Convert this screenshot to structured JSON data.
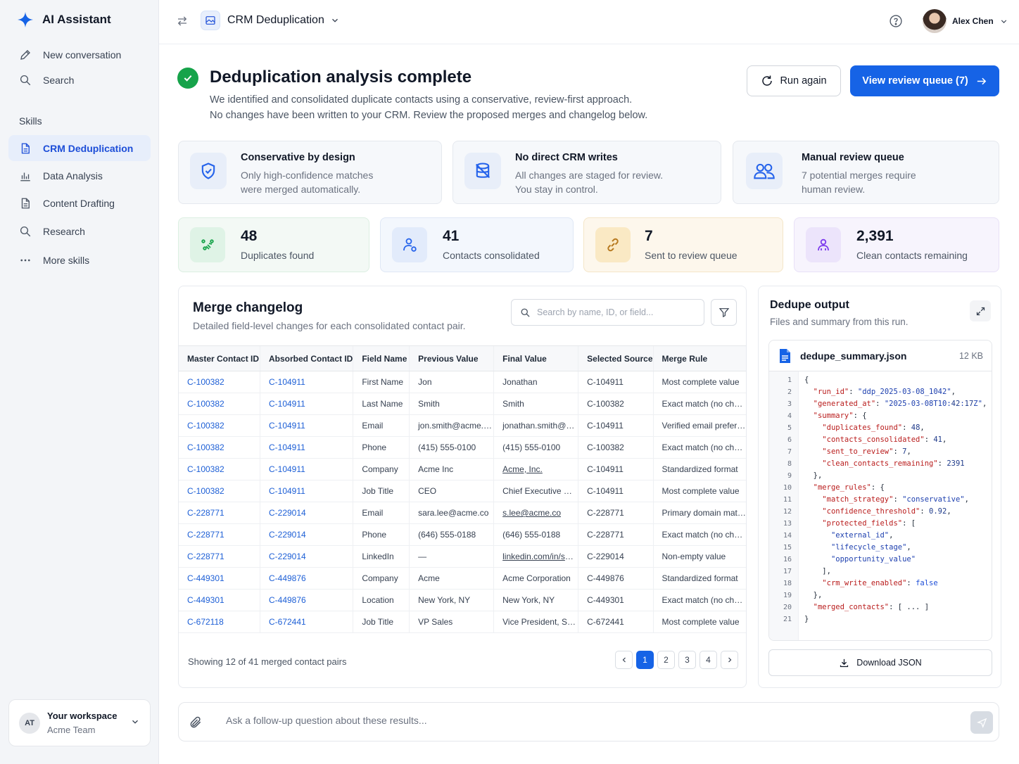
{
  "app": {
    "name": "AI Assistant"
  },
  "sidebar": {
    "new_conversation": "New conversation",
    "search": "Search",
    "skills_label": "Skills",
    "skills": [
      {
        "label": "CRM Deduplication",
        "icon": "document-icon",
        "active": true
      },
      {
        "label": "Data Analysis",
        "icon": "bar-chart-icon"
      },
      {
        "label": "Content Drafting",
        "icon": "document-icon"
      },
      {
        "label": "Research",
        "icon": "search-icon"
      },
      {
        "label": "More skills",
        "icon": "more-icon"
      }
    ],
    "workspace": {
      "initials": "AT",
      "title": "Your workspace",
      "team": "Acme Team"
    }
  },
  "topbar": {
    "skill": "CRM Deduplication",
    "user": "Alex Chen"
  },
  "header": {
    "title": "Deduplication analysis complete",
    "line1": "We identified and consolidated duplicate contacts using a conservative, review-first approach.",
    "line2": "No changes have been written to your CRM. Review the proposed merges and changelog below.",
    "run_again": "Run again",
    "view_queue": "View review queue (7)"
  },
  "features": [
    {
      "title": "Conservative by design",
      "line1": "Only high-confidence matches",
      "line2": "were merged automatically.",
      "icon": "shield-check-icon"
    },
    {
      "title": "No direct CRM writes",
      "line1": "All changes are staged for review.",
      "line2": "You stay in control.",
      "icon": "database-blocked-icon"
    },
    {
      "title": "Manual review queue",
      "line1": "7 potential merges require",
      "line2": "human review.",
      "icon": "users-icon"
    }
  ],
  "stats": [
    {
      "value": "48",
      "label": "Duplicates found",
      "color": "#16a34a"
    },
    {
      "value": "41",
      "label": "Contacts consolidated",
      "color": "#2563eb"
    },
    {
      "value": "7",
      "label": "Sent to review queue",
      "color": "#d97706"
    },
    {
      "value": "2,391",
      "label": "Clean contacts remaining",
      "color": "#7c3aed"
    }
  ],
  "changelog": {
    "title": "Merge changelog",
    "subtitle": "Detailed field-level changes for each consolidated contact pair.",
    "search_placeholder": "Search by name, ID, or field...",
    "columns": [
      "Master Contact ID",
      "Absorbed Contact ID",
      "Field Name",
      "Previous Value",
      "Final Value",
      "Selected Source",
      "Merge Rule"
    ],
    "rows": [
      [
        "C-100382",
        "C-104911",
        "First Name",
        "Jon",
        "Jonathan",
        "C-104911",
        "Most complete value"
      ],
      [
        "C-100382",
        "C-104911",
        "Last Name",
        "Smith",
        "Smith",
        "C-100382",
        "Exact match (no change)"
      ],
      [
        "C-100382",
        "C-104911",
        "Email",
        "jon.smith@acme.c...",
        "jonathan.smith@ac...",
        "C-104911",
        "Verified email preferred"
      ],
      [
        "C-100382",
        "C-104911",
        "Phone",
        "(415) 555-0100",
        "(415) 555-0100",
        "C-100382",
        "Exact match (no change)"
      ],
      [
        "C-100382",
        "C-104911",
        "Company",
        "Acme Inc",
        "Acme, Inc.",
        "C-104911",
        "Standardized format"
      ],
      [
        "C-100382",
        "C-104911",
        "Job Title",
        "CEO",
        "Chief Executive Offi...",
        "C-104911",
        "Most complete value"
      ],
      [
        "C-228771",
        "C-229014",
        "Email",
        "sara.lee@acme.co",
        "s.lee@acme.co",
        "C-228771",
        "Primary domain match"
      ],
      [
        "C-228771",
        "C-229014",
        "Phone",
        "(646) 555-0188",
        "(646) 555-0188",
        "C-228771",
        "Exact match (no change)"
      ],
      [
        "C-228771",
        "C-229014",
        "LinkedIn",
        "—",
        "linkedin.com/in/sar...",
        "C-229014",
        "Non-empty value"
      ],
      [
        "C-449301",
        "C-449876",
        "Company",
        "Acme",
        "Acme Corporation",
        "C-449876",
        "Standardized format"
      ],
      [
        "C-449301",
        "C-449876",
        "Location",
        "New York, NY",
        "New York, NY",
        "C-449301",
        "Exact match (no change)"
      ],
      [
        "C-672118",
        "C-672441",
        "Job Title",
        "VP Sales",
        "Vice President, Sales",
        "C-672441",
        "Most complete value"
      ]
    ],
    "underlined_final": [
      4,
      6,
      8
    ],
    "footer": "Showing 12 of 41 merged contact pairs",
    "pages": [
      "1",
      "2",
      "3",
      "4"
    ],
    "current_page": "1"
  },
  "output": {
    "title": "Dedupe output",
    "subtitle": "Files and summary from this run.",
    "file_name": "dedupe_summary.json",
    "file_size": "12 KB",
    "code": [
      "{",
      "  \"run_id\": \"ddp_2025-03-08_1042\",",
      "  \"generated_at\": \"2025-03-08T10:42:17Z\",",
      "  \"summary\": {",
      "    \"duplicates_found\": 48,",
      "    \"contacts_consolidated\": 41,",
      "    \"sent_to_review\": 7,",
      "    \"clean_contacts_remaining\": 2391",
      "  },",
      "  \"merge_rules\": {",
      "    \"match_strategy\": \"conservative\",",
      "    \"confidence_threshold\": 0.92,",
      "    \"protected_fields\": [",
      "      \"external_id\",",
      "      \"lifecycle_stage\",",
      "      \"opportunity_value\"",
      "    ],",
      "    \"crm_write_enabled\": false",
      "  },",
      "  \"merged_contacts\": [ ... ]",
      "}"
    ],
    "download": "Download JSON"
  },
  "ask": {
    "placeholder": "Ask a follow-up question about these results..."
  },
  "colors": {
    "accent": "#1663e6",
    "success": "#16a34a",
    "link": "#1d5fd6"
  }
}
